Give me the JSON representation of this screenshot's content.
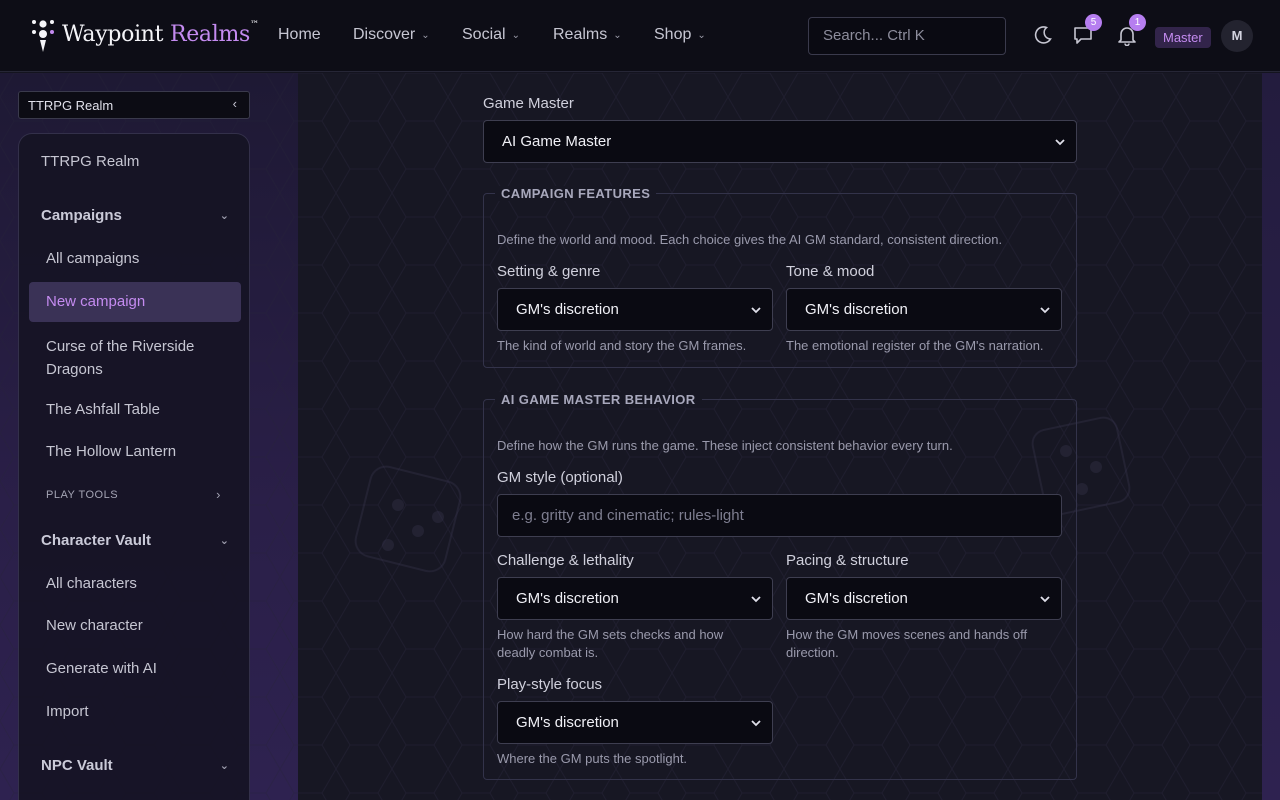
{
  "header": {
    "brand_first": "Waypoint",
    "brand_second": "Realms",
    "brand_tm": "™",
    "nav": [
      {
        "label": "Home",
        "has_menu": false
      },
      {
        "label": "Discover",
        "has_menu": true
      },
      {
        "label": "Social",
        "has_menu": true
      },
      {
        "label": "Realms",
        "has_menu": true
      },
      {
        "label": "Shop",
        "has_menu": true
      }
    ],
    "search_placeholder": "Search... Ctrl K",
    "messages_count": "5",
    "notifications_count": "1",
    "role": "Master",
    "avatar_initial": "M",
    "accent": "#b67ef0"
  },
  "sidebar": {
    "realm_select": "TTRPG Realm",
    "realm_title": "TTRPG Realm",
    "campaigns": {
      "title": "Campaigns",
      "items": [
        "All campaigns",
        "New campaign",
        "Curse of the Riverside Dragons",
        "The Ashfall Table",
        "The Hollow Lantern"
      ],
      "active": "New campaign"
    },
    "play_tools": "PLAY TOOLS",
    "character_vault": {
      "title": "Character Vault",
      "items": [
        "All characters",
        "New character",
        "Generate with AI",
        "Import"
      ]
    },
    "npc_vault": {
      "title": "NPC Vault"
    }
  },
  "form": {
    "game_master": {
      "label": "Game Master",
      "value": "AI Game Master"
    },
    "campaign_features": {
      "legend": "CAMPAIGN FEATURES",
      "description": "Define the world and mood. Each choice gives the AI GM standard, consistent direction.",
      "setting": {
        "label": "Setting & genre",
        "value": "GM's discretion",
        "help": "The kind of world and story the GM frames."
      },
      "tone": {
        "label": "Tone & mood",
        "value": "GM's discretion",
        "help": "The emotional register of the GM's narration."
      }
    },
    "gm_behavior": {
      "legend": "AI GAME MASTER BEHAVIOR",
      "description": "Define how the GM runs the game. These inject consistent behavior every turn.",
      "style": {
        "label": "GM style (optional)",
        "placeholder": "e.g. gritty and cinematic; rules-light",
        "value": ""
      },
      "challenge": {
        "label": "Challenge & lethality",
        "value": "GM's discretion",
        "help_1": "How hard the GM sets checks and how",
        "help_2": "deadly combat is."
      },
      "pacing": {
        "label": "Pacing & structure",
        "value": "GM's discretion",
        "help_1": "How the GM moves scenes and hands off",
        "help_2": "direction."
      },
      "playstyle": {
        "label": "Play-style focus",
        "value": "GM's discretion",
        "help": "Where the GM puts the spotlight."
      }
    }
  }
}
